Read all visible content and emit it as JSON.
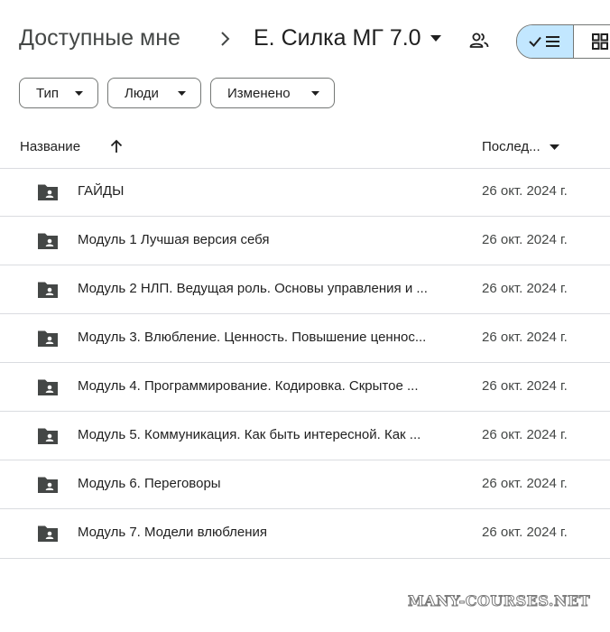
{
  "breadcrumb": {
    "root": "Доступные мне",
    "current": "Е. Силка МГ 7.0"
  },
  "filters": [
    {
      "label": "Тип"
    },
    {
      "label": "Люди"
    },
    {
      "label": "Изменено"
    }
  ],
  "columns": {
    "name": "Название",
    "modified": "Послед..."
  },
  "rows": [
    {
      "name": "ГАЙДЫ",
      "date": "26 окт. 2024 г."
    },
    {
      "name": "Модуль 1 Лучшая версия себя",
      "date": "26 окт. 2024 г."
    },
    {
      "name": "Модуль 2 НЛП. Ведущая роль. Основы управления и ...",
      "date": "26 окт. 2024 г."
    },
    {
      "name": "Модуль 3. Влюбление. Ценность. Повышение ценнос...",
      "date": "26 окт. 2024 г."
    },
    {
      "name": "Модуль 4. Программирование. Кодировка. Скрытое ...",
      "date": "26 окт. 2024 г."
    },
    {
      "name": "Модуль 5. Коммуникация. Как быть интересной. Как ...",
      "date": "26 окт. 2024 г."
    },
    {
      "name": "Модуль 6. Переговоры",
      "date": "26 окт. 2024 г."
    },
    {
      "name": "Модуль 7. Модели влюбления",
      "date": "26 окт. 2024 г."
    }
  ],
  "icons": {
    "folder": "shared-folder-icon",
    "share": "people-icon",
    "list_view": "check-list-icon",
    "grid_view": "grid-icon",
    "sort": "arrow-up-icon"
  },
  "colors": {
    "accent": "#c2e7ff",
    "text": "#1f1f1f",
    "secondary": "#444746",
    "divider": "#dadce0"
  },
  "watermark": {
    "text": "MANY-COURSES.NET"
  }
}
